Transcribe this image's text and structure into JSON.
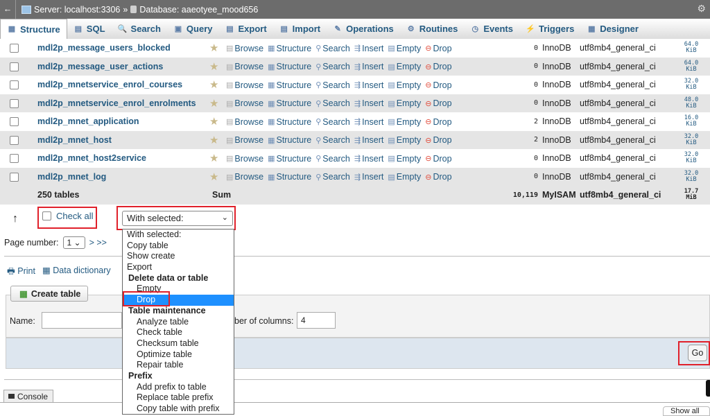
{
  "titlebar": {
    "back": "←",
    "server": "Server: localhost:3306",
    "sep": "»",
    "database": "Database: aaeotyee_mood656",
    "gear": "⚙"
  },
  "tabs": [
    {
      "label": "Structure",
      "icon": "structure-icon",
      "glyph": "▦",
      "active": true
    },
    {
      "label": "SQL",
      "icon": "sql-icon",
      "glyph": "▤"
    },
    {
      "label": "Search",
      "icon": "search-icon",
      "glyph": "🔍"
    },
    {
      "label": "Query",
      "icon": "query-icon",
      "glyph": "▣"
    },
    {
      "label": "Export",
      "icon": "export-icon",
      "glyph": "▤"
    },
    {
      "label": "Import",
      "icon": "import-icon",
      "glyph": "▤"
    },
    {
      "label": "Operations",
      "icon": "operations-icon",
      "glyph": "✎"
    },
    {
      "label": "Routines",
      "icon": "routines-icon",
      "glyph": "⚙"
    },
    {
      "label": "Events",
      "icon": "events-icon",
      "glyph": "◷"
    },
    {
      "label": "Triggers",
      "icon": "triggers-icon",
      "glyph": "⚡"
    },
    {
      "label": "Designer",
      "icon": "designer-icon",
      "glyph": "▦"
    }
  ],
  "actions": {
    "browse": "Browse",
    "structure": "Structure",
    "search": "Search",
    "insert": "Insert",
    "empty": "Empty",
    "drop": "Drop"
  },
  "rows": [
    {
      "name": "mdl2p_message_users_blocked",
      "rows": "0",
      "engine": "InnoDB",
      "collation": "utf8mb4_general_ci",
      "size_num": "64.0",
      "size_unit": "KiB"
    },
    {
      "name": "mdl2p_message_user_actions",
      "rows": "0",
      "engine": "InnoDB",
      "collation": "utf8mb4_general_ci",
      "size_num": "64.0",
      "size_unit": "KiB"
    },
    {
      "name": "mdl2p_mnetservice_enrol_courses",
      "rows": "0",
      "engine": "InnoDB",
      "collation": "utf8mb4_general_ci",
      "size_num": "32.0",
      "size_unit": "KiB"
    },
    {
      "name": "mdl2p_mnetservice_enrol_enrolments",
      "rows": "0",
      "engine": "InnoDB",
      "collation": "utf8mb4_general_ci",
      "size_num": "48.0",
      "size_unit": "KiB"
    },
    {
      "name": "mdl2p_mnet_application",
      "rows": "2",
      "engine": "InnoDB",
      "collation": "utf8mb4_general_ci",
      "size_num": "16.0",
      "size_unit": "KiB"
    },
    {
      "name": "mdl2p_mnet_host",
      "rows": "2",
      "engine": "InnoDB",
      "collation": "utf8mb4_general_ci",
      "size_num": "32.0",
      "size_unit": "KiB"
    },
    {
      "name": "mdl2p_mnet_host2service",
      "rows": "0",
      "engine": "InnoDB",
      "collation": "utf8mb4_general_ci",
      "size_num": "32.0",
      "size_unit": "KiB"
    },
    {
      "name": "mdl2p_mnet_log",
      "rows": "0",
      "engine": "InnoDB",
      "collation": "utf8mb4_general_ci",
      "size_num": "32.0",
      "size_unit": "KiB"
    }
  ],
  "summary": {
    "tables": "250 tables",
    "sum": "Sum",
    "rows": "10,119",
    "engine": "MyISAM",
    "collation": "utf8mb4_general_ci",
    "size_num": "17.7",
    "size_unit": "MiB"
  },
  "bulk": {
    "arrow": "↑",
    "check_all": "Check all",
    "with_selected": "With selected:"
  },
  "dropdown": {
    "top": "With selected:",
    "items1": [
      "Copy table",
      "Show create",
      "Export"
    ],
    "group1": "Delete data or table",
    "group1_items": [
      "Empty",
      "Drop"
    ],
    "group2": "Table maintenance",
    "group2_items": [
      "Analyze table",
      "Check table",
      "Checksum table",
      "Optimize table",
      "Repair table"
    ],
    "group3": "Prefix",
    "group3_items": [
      "Add prefix to table",
      "Replace table prefix",
      "Copy table with prefix"
    ]
  },
  "pagination": {
    "label": "Page number:",
    "value": "1",
    "next": "> >>"
  },
  "links": {
    "print": "Print",
    "dictionary": "Data dictionary"
  },
  "create": {
    "button": "Create table",
    "name_label": "Name:",
    "columns_label": "ber of columns:",
    "columns_value": "4",
    "go": "Go"
  },
  "console": {
    "label": "Console"
  },
  "show_all": "Show all"
}
